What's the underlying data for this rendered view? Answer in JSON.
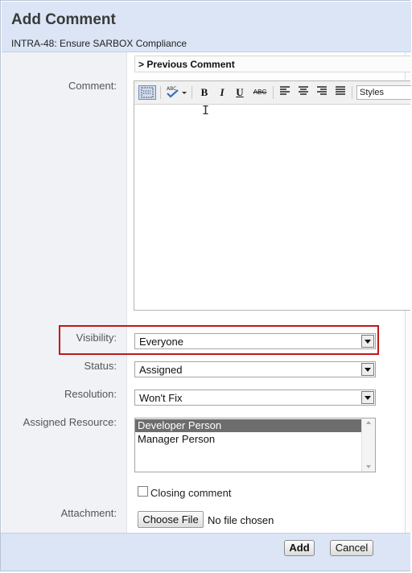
{
  "dialog": {
    "title": "Add Comment",
    "issue": "INTRA-48: Ensure SARBOX Compliance"
  },
  "previous_comment": "> Previous Comment",
  "labels": {
    "comment": "Comment:",
    "visibility": "Visibility:",
    "status": "Status:",
    "resolution": "Resolution:",
    "assigned_resource": "Assigned Resource:",
    "attachment": "Attachment:"
  },
  "editor": {
    "toolbar": {
      "bold": "B",
      "italic": "I",
      "underline": "U",
      "strikethrough": "ABC",
      "styles": "Styles"
    },
    "content": ""
  },
  "fields": {
    "visibility": "Everyone",
    "status": "Assigned",
    "resolution": "Won't Fix",
    "assigned_resource_options": [
      "Developer Person",
      "Manager Person"
    ],
    "assigned_resource_selected": "Developer Person"
  },
  "closing_comment": {
    "label": "Closing comment",
    "checked": false
  },
  "attachment": {
    "button": "Choose File",
    "status": "No file chosen"
  },
  "buttons": {
    "add": "Add",
    "cancel": "Cancel"
  },
  "colors": {
    "header_bg": "#dbe5f5",
    "highlight": "#c0181a",
    "selected_option": "#6d6d6d"
  }
}
